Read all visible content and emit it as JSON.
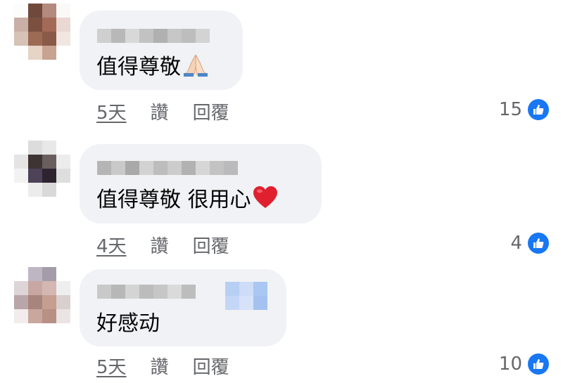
{
  "comments": [
    {
      "text": "值得尊敬",
      "emoji": "folded-hands",
      "time": "5天",
      "like_label": "讚",
      "reply_label": "回覆",
      "reaction_count": "15",
      "reaction_icon": "thumbs-up-icon"
    },
    {
      "text": "值得尊敬 很用心",
      "emoji": "red-heart",
      "time": "4天",
      "like_label": "讚",
      "reply_label": "回覆",
      "reaction_count": "4",
      "reaction_icon": "thumbs-up-icon"
    },
    {
      "text": "好感动",
      "emoji": "",
      "time": "5天",
      "like_label": "讚",
      "reply_label": "回覆",
      "reaction_count": "10",
      "reaction_icon": "thumbs-up-icon"
    }
  ],
  "colors": {
    "bubble": "#f0f2f5",
    "meta_text": "#65676b",
    "like_blue": "#1877f2",
    "name_blur": "#c8c8c8"
  }
}
